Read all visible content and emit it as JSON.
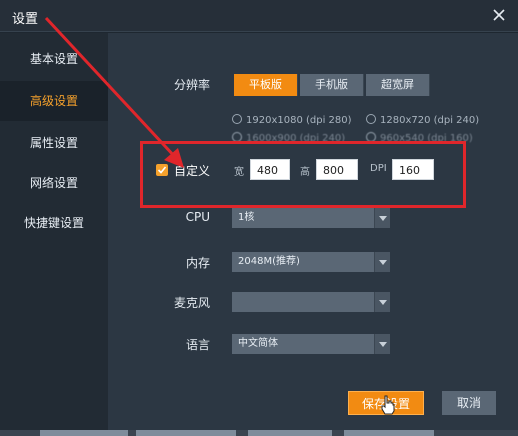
{
  "window": {
    "title": "设置"
  },
  "sidebar": {
    "items": [
      {
        "label": "基本设置",
        "active": false
      },
      {
        "label": "高级设置",
        "active": true
      },
      {
        "label": "属性设置",
        "active": false
      },
      {
        "label": "网络设置",
        "active": false
      },
      {
        "label": "快捷键设置",
        "active": false
      }
    ]
  },
  "resolution": {
    "label": "分辨率",
    "tabs": [
      {
        "label": "平板版",
        "active": true
      },
      {
        "label": "手机版",
        "active": false
      },
      {
        "label": "超宽屏",
        "active": false
      }
    ],
    "options": [
      {
        "label": "1920x1080 (dpi 280)"
      },
      {
        "label": "1280x720 (dpi 240)"
      },
      {
        "label": "1600x900 (dpi 240)"
      },
      {
        "label": "960x540 (dpi 160)"
      }
    ]
  },
  "custom": {
    "label": "自定义",
    "checked": true,
    "width_label": "宽",
    "width_value": "480",
    "height_label": "高",
    "height_value": "800",
    "dpi_label": "DPI",
    "dpi_value": "160"
  },
  "cpu": {
    "label": "CPU",
    "value": "1核"
  },
  "memory": {
    "label": "内存",
    "value": "2048M(推荐)"
  },
  "microphone": {
    "label": "麦克风",
    "value": ""
  },
  "language": {
    "label": "语言",
    "value": "中文简体"
  },
  "buttons": {
    "save": "保存设置",
    "cancel": "取消"
  },
  "colors": {
    "accent": "#f28b12",
    "highlight_box": "#e0262b",
    "active_nav": "#f5a12c"
  },
  "icons": {
    "close": "close-icon",
    "check": "check-icon",
    "dropdown": "chevron-down-icon",
    "cursor": "hand-cursor-icon",
    "annotation": "red-arrow-annotation"
  }
}
